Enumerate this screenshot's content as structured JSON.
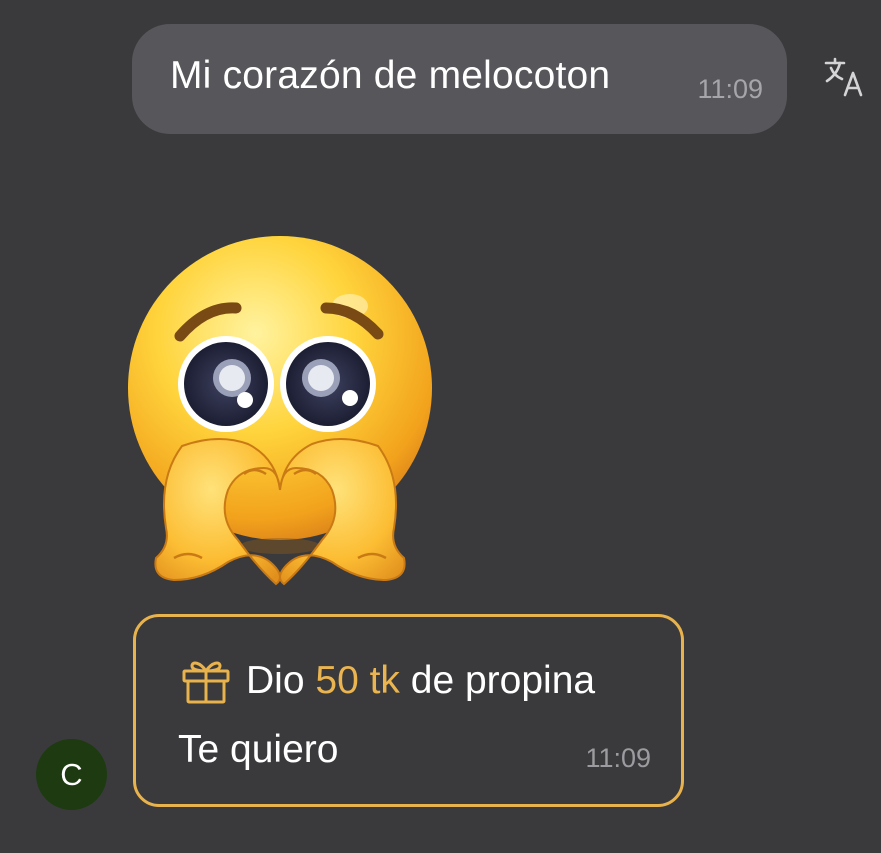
{
  "message": {
    "text": "Mi corazón de melocoton",
    "time": "11:09"
  },
  "translate": {
    "icon": "translate-icon"
  },
  "sticker": {
    "icon": "pleading-face-heart-hands-sticker"
  },
  "tip": {
    "prefix": "Dio",
    "amount": "50 tk",
    "suffix": "de propina",
    "message": "Te quiero",
    "time": "11:09",
    "icon": "gift-icon",
    "accent_color": "#e8b24d"
  },
  "avatar": {
    "initial": "C",
    "color": "#1d3a10"
  },
  "colors": {
    "background": "#3a3a3d",
    "bubble": "#57575b"
  }
}
